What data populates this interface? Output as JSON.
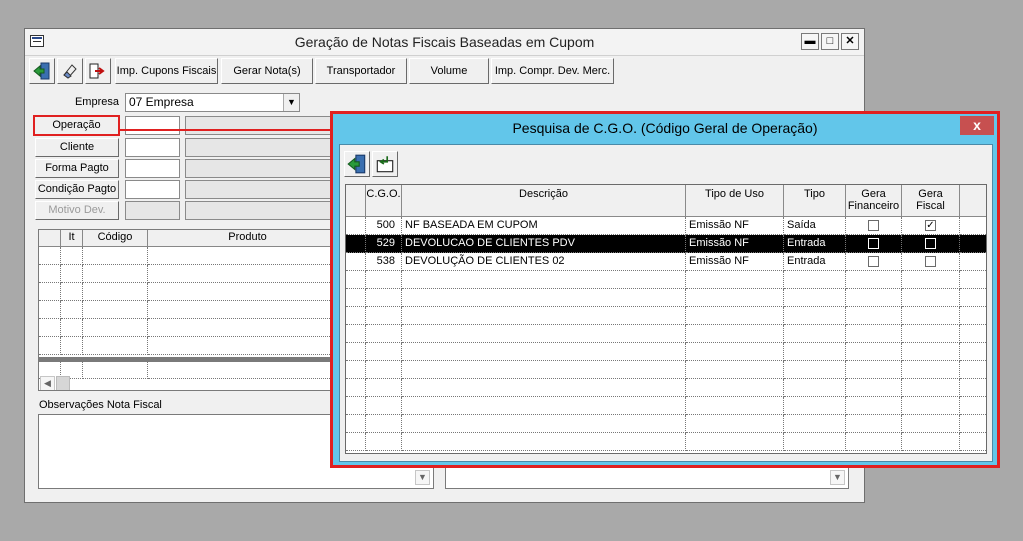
{
  "main_window": {
    "title": "Geração de Notas Fiscais Baseadas em Cupom",
    "controls": {
      "minimize": "▬",
      "maximize": "□",
      "close": "✕"
    }
  },
  "toolbar": {
    "icons": [
      "exit-icon",
      "eraser-icon",
      "export-icon"
    ],
    "buttons": [
      "Imp. Cupons Fiscais",
      "Gerar Nota(s)",
      "Transportador",
      "Volume",
      "Imp. Compr. Dev. Merc."
    ]
  },
  "form": {
    "empresa_label": "Empresa",
    "empresa_value": "07 Empresa",
    "operacao_label": "Operação",
    "cliente_label": "Cliente",
    "forma_pagto_label": "Forma Pagto",
    "condicao_pagto_label": "Condição Pagto",
    "motivo_dev_label": "Motivo Dev."
  },
  "products_grid": {
    "columns": [
      "It",
      "Código",
      "Produto"
    ]
  },
  "observations": {
    "label": "Observações Nota Fiscal"
  },
  "dialog": {
    "title": "Pesquisa de C.G.O. (Código Geral de Operação)",
    "close": "x",
    "columns": {
      "cgo": "C.G.O.",
      "descricao": "Descrição",
      "tipo_uso": "Tipo de Uso",
      "tipo": "Tipo",
      "gera_financeiro_1": "Gera",
      "gera_financeiro_2": "Financeiro",
      "gera_fiscal_1": "Gera",
      "gera_fiscal_2": "Fiscal"
    },
    "rows": [
      {
        "cgo": "500",
        "descricao": "NF BASEADA EM CUPOM",
        "tipo_uso": "Emissão NF",
        "tipo": "Saída",
        "gera_financeiro": false,
        "gera_fiscal": true,
        "selected": false
      },
      {
        "cgo": "529",
        "descricao": "DEVOLUCAO DE CLIENTES PDV",
        "tipo_uso": "Emissão NF",
        "tipo": "Entrada",
        "gera_financeiro": false,
        "gera_fiscal": false,
        "selected": true
      },
      {
        "cgo": "538",
        "descricao": "DEVOLUÇÃO DE CLIENTES 02",
        "tipo_uso": "Emissão NF",
        "tipo": "Entrada",
        "gera_financeiro": false,
        "gera_fiscal": false,
        "selected": false
      }
    ]
  },
  "colors": {
    "dialog_frame": "#62c6ea",
    "highlight": "#e02020",
    "selected_row": "#000000"
  }
}
